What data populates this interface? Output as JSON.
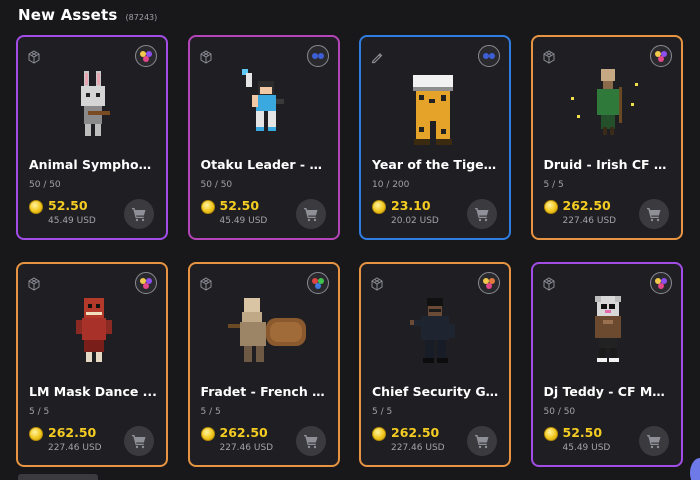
{
  "header": {
    "title": "New Assets",
    "count": "(87243)"
  },
  "assets": [
    {
      "name": "Animal Symphon...",
      "edition": "50 / 50",
      "price": "52.50",
      "usd": "45.49 USD",
      "border": "#a14de6",
      "badge": "tri",
      "art": "bunny"
    },
    {
      "name": "Otaku Leader - C...",
      "edition": "50 / 50",
      "price": "52.50",
      "usd": "45.49 USD",
      "border": "#b445b8",
      "badge": "navy",
      "art": "otaku"
    },
    {
      "name": "Year of the Tiger ...",
      "edition": "10 / 200",
      "price": "23.10",
      "usd": "20.02 USD",
      "border": "#2f7de1",
      "badge": "navy",
      "art": "tiger"
    },
    {
      "name": "Druid - Irish CF F...",
      "edition": "5 / 5",
      "price": "262.50",
      "usd": "227.46 USD",
      "border": "#e69442",
      "badge": "tri",
      "art": "druid"
    },
    {
      "name": "LM Mask Dance ...",
      "edition": "5 / 5",
      "price": "262.50",
      "usd": "227.46 USD",
      "border": "#e69442",
      "badge": "tri",
      "art": "mask"
    },
    {
      "name": "Fradet - French C...",
      "edition": "5 / 5",
      "price": "262.50",
      "usd": "227.46 USD",
      "border": "#e69442",
      "badge": "rgb",
      "art": "fradet"
    },
    {
      "name": "Chief Security Gu...",
      "edition": "5 / 5",
      "price": "262.50",
      "usd": "227.46 USD",
      "border": "#e69442",
      "badge": "warm",
      "art": "guard"
    },
    {
      "name": "Dj Teddy - CF Mu...",
      "edition": "50 / 50",
      "price": "52.50",
      "usd": "45.49 USD",
      "border": "#a14de6",
      "badge": "tri",
      "art": "teddy"
    }
  ],
  "icons": {
    "type": "voxel-icon",
    "cart": "cart-icon",
    "coin": "coin-icon"
  },
  "colors": {
    "background": "#18181b",
    "price": "#f4cc22",
    "muted": "#a1a1aa"
  }
}
